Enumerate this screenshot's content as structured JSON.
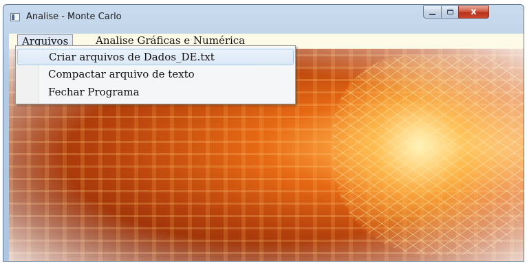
{
  "window": {
    "title": "Analise - Monte Carlo",
    "close_glyph": "x"
  },
  "menubar": {
    "items": [
      {
        "label": "Arquivos"
      },
      {
        "label": "Analise Gráficas e Numérica"
      }
    ]
  },
  "dropdown": {
    "items": [
      {
        "label": "Criar arquivos de Dados_DE.txt"
      },
      {
        "label": "Compactar arquivo de texto"
      },
      {
        "label": "Fechar Programa"
      }
    ]
  },
  "icons": {
    "app": "app-window-icon",
    "minimize": "minimize-icon",
    "maximize": "maximize-icon",
    "close": "close-icon"
  },
  "colors": {
    "menubar_bg": "#fdfbe7",
    "close_button": "#c9492e",
    "menu_hover": "#dbe8f6"
  }
}
